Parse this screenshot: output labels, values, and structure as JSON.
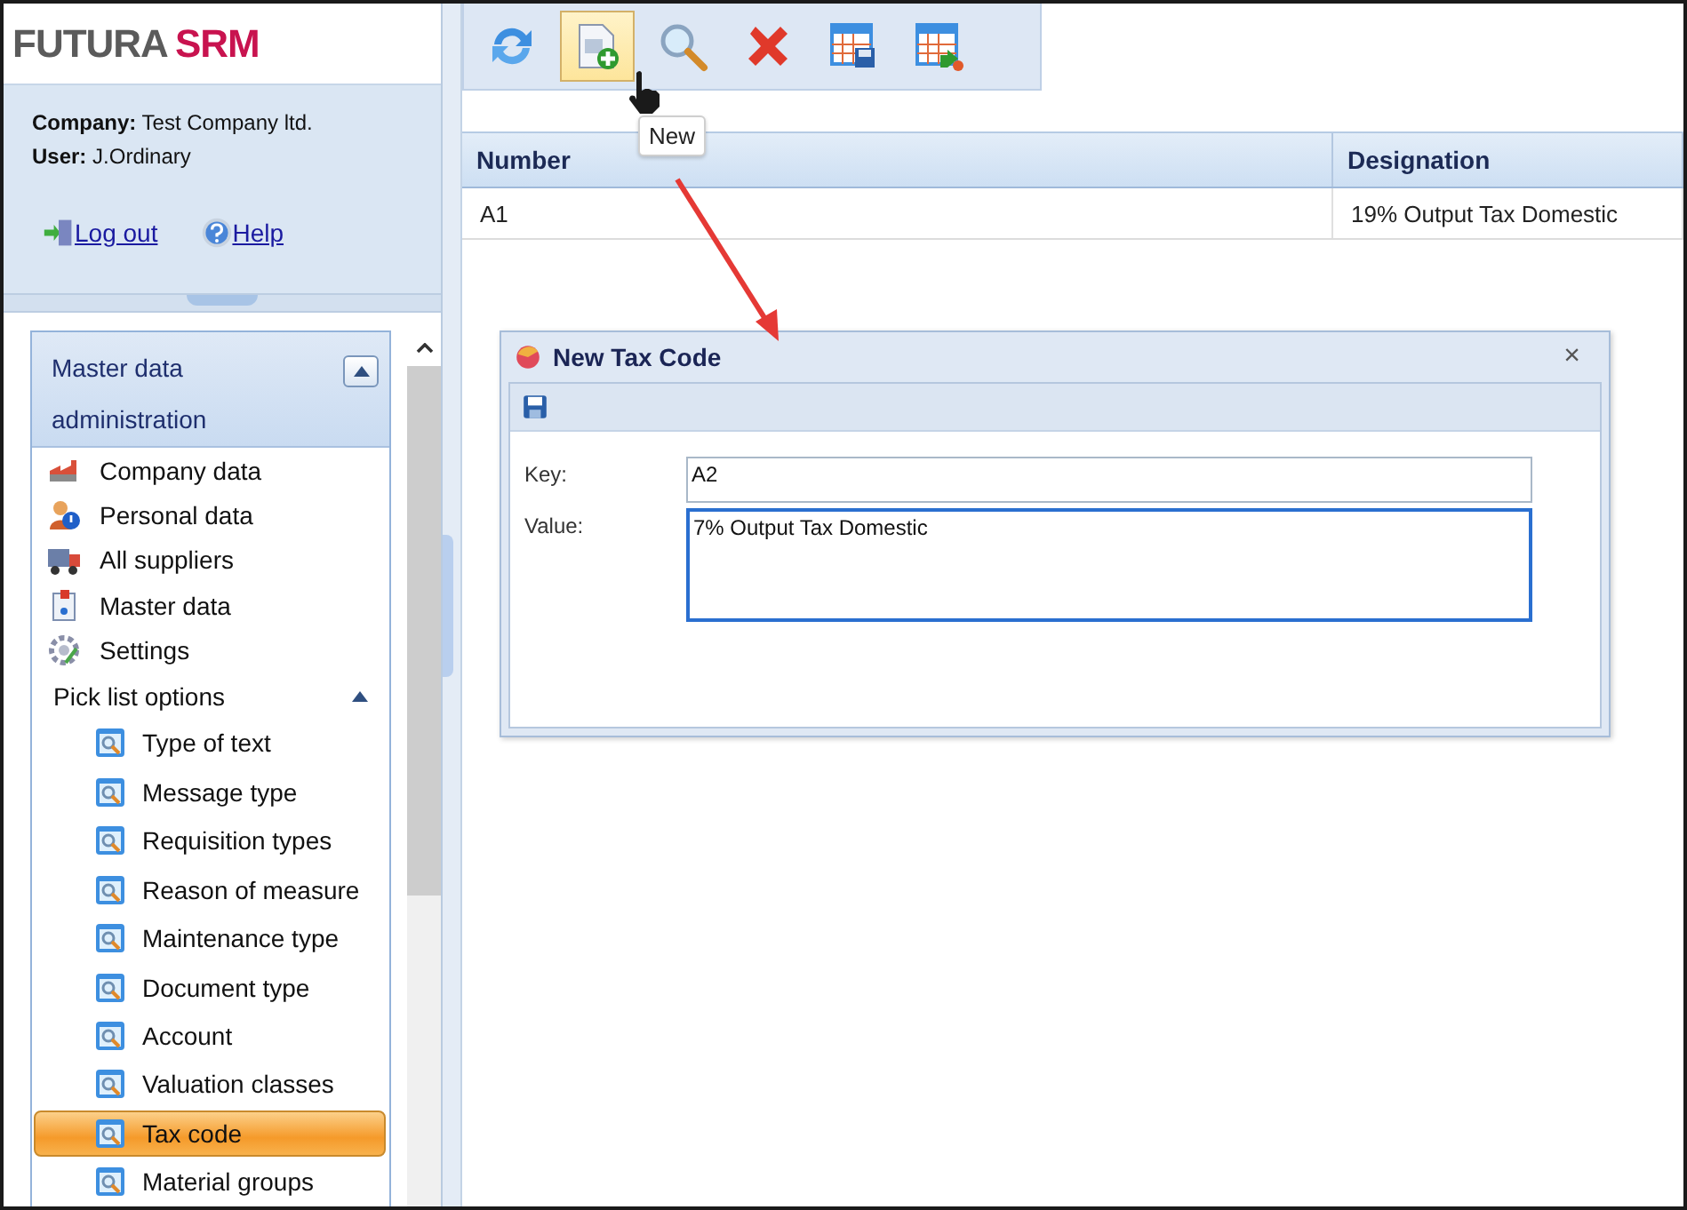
{
  "logo": {
    "part1": "FUTURA",
    "part2": "SRM"
  },
  "account": {
    "company_label": "Company:",
    "company": "Test Company ltd.",
    "user_label": "User:",
    "user": "J.Ordinary"
  },
  "links": [
    {
      "label": "Log out",
      "kind": "logout"
    },
    {
      "label": "Help",
      "kind": "help"
    }
  ],
  "nav": {
    "title": "Master data administration",
    "expanded": true,
    "items": [
      {
        "label": "Company data",
        "kind": "factory"
      },
      {
        "label": "Personal data",
        "kind": "person"
      },
      {
        "label": "All suppliers",
        "kind": "truck"
      },
      {
        "label": "Master data",
        "kind": "document"
      },
      {
        "label": "Settings",
        "kind": "gear"
      }
    ],
    "group": {
      "label": "Pick list options",
      "expanded": true,
      "children": [
        {
          "label": "Type of text",
          "selected": false
        },
        {
          "label": "Message type",
          "selected": false
        },
        {
          "label": "Requisition types",
          "selected": false
        },
        {
          "label": "Reason of measure",
          "selected": false
        },
        {
          "label": "Maintenance type",
          "selected": false
        },
        {
          "label": "Document type",
          "selected": false
        },
        {
          "label": "Account",
          "selected": false
        },
        {
          "label": "Valuation classes",
          "selected": false
        },
        {
          "label": "Tax code",
          "selected": true
        },
        {
          "label": "Material groups",
          "selected": false
        }
      ]
    }
  },
  "toolbar": [
    {
      "kind": "refresh",
      "hovered": false
    },
    {
      "kind": "new",
      "hovered": true
    },
    {
      "kind": "search",
      "hovered": false
    },
    {
      "kind": "delete",
      "hovered": false
    },
    {
      "kind": "table-save",
      "hovered": false
    },
    {
      "kind": "table-export",
      "hovered": false
    }
  ],
  "tooltip": "New",
  "table": {
    "columns": [
      "Number",
      "Designation"
    ],
    "rows": [
      [
        "A1",
        "19% Output Tax Domestic"
      ]
    ]
  },
  "dialog": {
    "title": "New Tax Code",
    "close": "×",
    "fields": [
      {
        "label": "Key:",
        "value": "A2",
        "kind": "text",
        "focused": false
      },
      {
        "label": "Value:",
        "value": "7% Output Tax Domestic",
        "kind": "textarea",
        "focused": true
      }
    ]
  }
}
